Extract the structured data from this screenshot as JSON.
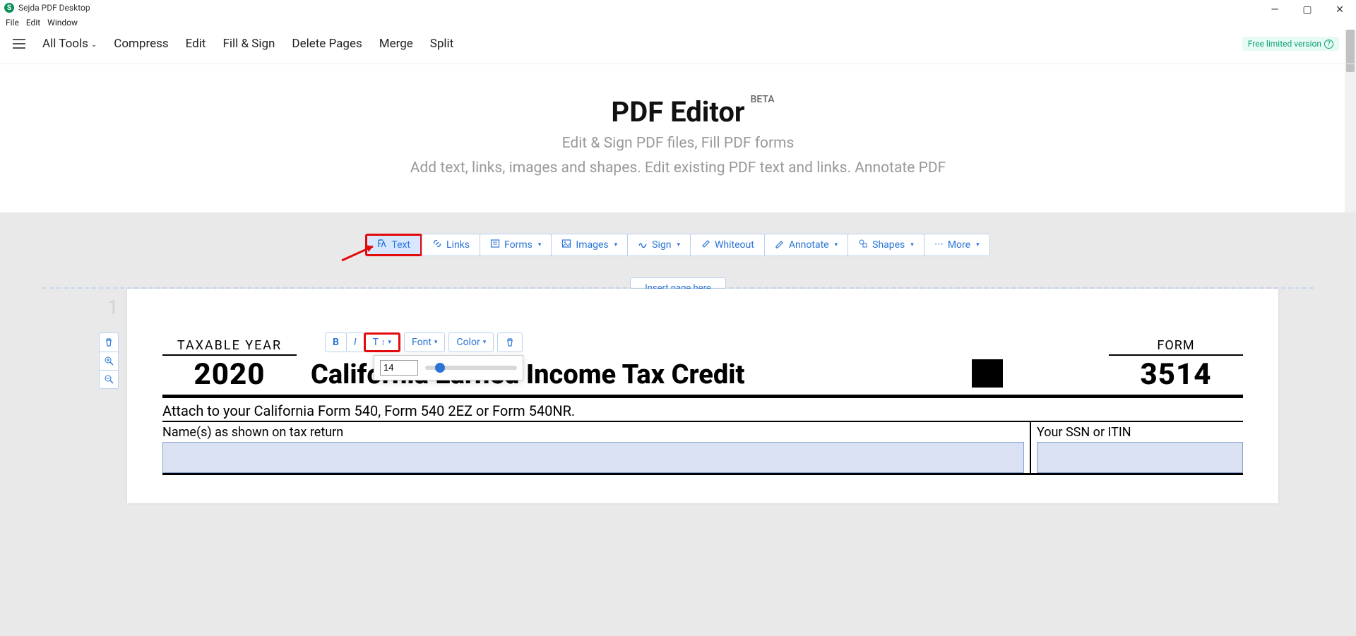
{
  "app": {
    "title": "Sejda PDF Desktop"
  },
  "menubar": {
    "file": "File",
    "edit": "Edit",
    "window": "Window"
  },
  "nav": {
    "all_tools": "All Tools",
    "compress": "Compress",
    "edit": "Edit",
    "fill_sign": "Fill & Sign",
    "delete_pages": "Delete Pages",
    "merge": "Merge",
    "split": "Split",
    "free_version": "Free limited version"
  },
  "header": {
    "title": "PDF Editor",
    "beta": "BETA",
    "sub1": "Edit & Sign PDF files, Fill PDF forms",
    "sub2": "Add text, links, images and shapes. Edit existing PDF text and links. Annotate PDF"
  },
  "tools": {
    "text": "Text",
    "links": "Links",
    "forms": "Forms",
    "images": "Images",
    "sign": "Sign",
    "whiteout": "Whiteout",
    "annotate": "Annotate",
    "shapes": "Shapes",
    "more": "More"
  },
  "insert_page": "Insert page here",
  "page_number": "1",
  "fmt": {
    "bold": "B",
    "italic": "I",
    "size_label": "T",
    "font": "Font",
    "color": "Color",
    "font_size_value": "14"
  },
  "doc": {
    "taxable_year_label": "TAXABLE YEAR",
    "year": "2020",
    "form_label": "FORM",
    "form_number": "3514",
    "title": "California Earned Income Tax Credit",
    "attach": "Attach to your California Form 540, Form 540 2EZ or Form 540NR.",
    "name_label": "Name(s) as shown on tax return",
    "ssn_label": "Your SSN or ITIN"
  }
}
